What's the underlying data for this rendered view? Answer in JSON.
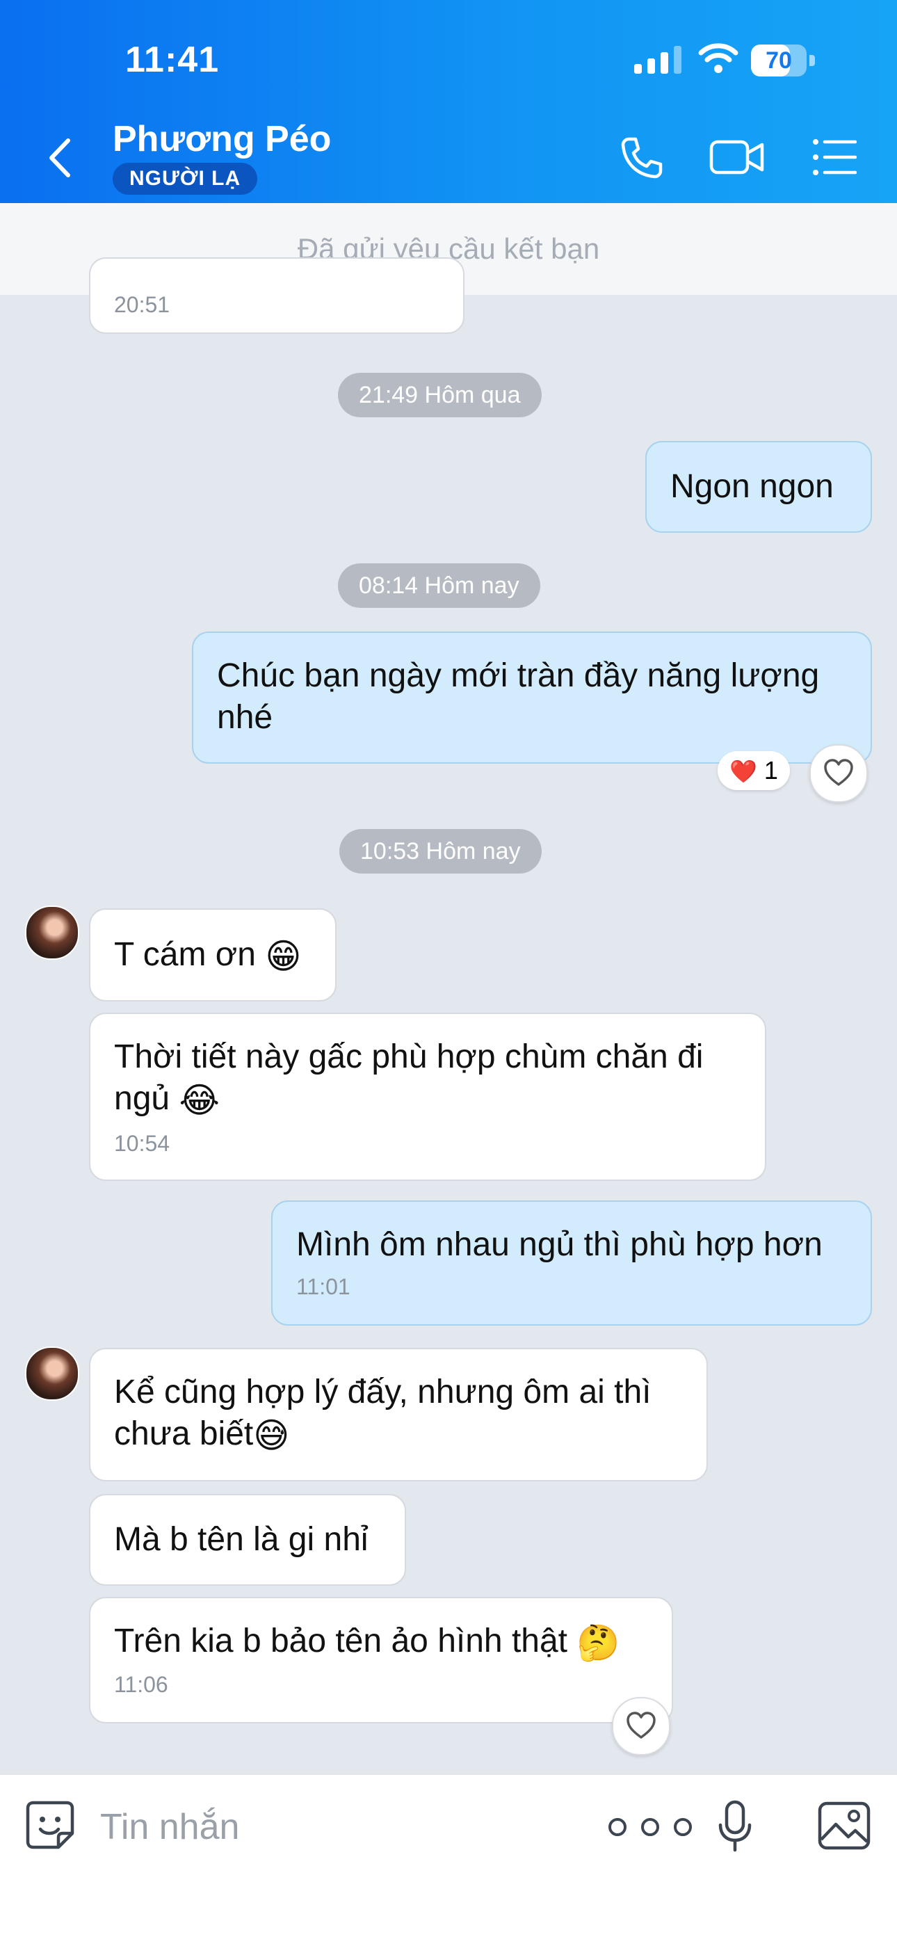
{
  "status_bar": {
    "time": "11:41",
    "battery_level": "70",
    "battery_fraction": 0.7
  },
  "header": {
    "contact_name": "Phương Péo",
    "badge": "NGƯỜI LẠ"
  },
  "banner": {
    "text": "Đã gửi yêu cầu kết bạn"
  },
  "messages": {
    "top_partial_time": "20:51",
    "sep1": "21:49 Hôm qua",
    "m1": {
      "text": "Ngon ngon"
    },
    "sep2": "08:14 Hôm nay",
    "m2": {
      "line1": "Chúc bạn ngày mới tràn đầy năng lượng",
      "line2": "nhé",
      "reaction_emoji": "❤️",
      "reaction_count": "1"
    },
    "sep3": "10:53 Hôm nay",
    "m3": {
      "text": "T cám ơn",
      "emoji": "😁"
    },
    "m4": {
      "line1": "Thời tiết này gấc phù hợp chùm chăn đi",
      "line2": "ngủ",
      "emoji": "😂",
      "time": "10:54"
    },
    "m5": {
      "text": "Mình ôm nhau ngủ thì phù hợp hơn",
      "time": "11:01"
    },
    "m6": {
      "line1": "Kể cũng hợp lý đấy, nhưng ôm ai thì",
      "line2": "chưa biết",
      "emoji": "😅"
    },
    "m7": {
      "text": "Mà b tên là gi nhỉ"
    },
    "m8": {
      "text": "Trên kia b bảo tên ảo hình thật",
      "emoji": "🤔",
      "time": "11:06"
    }
  },
  "input": {
    "placeholder": "Tin nhắn"
  },
  "icons": {
    "back": "chevron-left-icon",
    "call": "phone-icon",
    "video": "video-camera-icon",
    "menu": "list-icon",
    "sticker": "sticker-smile-icon",
    "more": "more-dots-icon",
    "mic": "microphone-icon",
    "image": "image-icon",
    "heart": "heart-outline-icon"
  },
  "colors": {
    "header_start": "#0a6ff0",
    "header_end": "#16a4f6",
    "outgoing_bubble": "#d3ecfd",
    "incoming_bubble": "#ffffff",
    "chat_background": "#e3e7ee"
  }
}
